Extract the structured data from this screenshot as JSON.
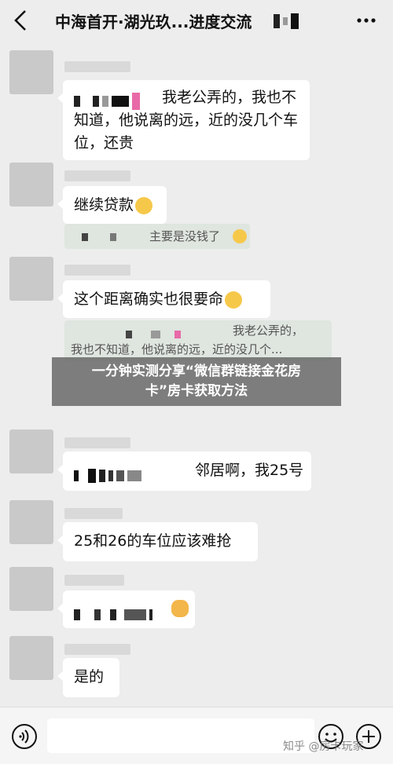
{
  "header": {
    "title": "中海首开·湖光玖...进度交流"
  },
  "messages": [
    {
      "text_visible": "我老公弄的，我也不知道，他说离的远，近的没几个车位，还贵"
    },
    {
      "text": "继续贷款"
    },
    {
      "quote": "主要是没钱了"
    },
    {
      "text": "这个距离确实也很要命"
    },
    {
      "quote_line1": "我老公弄的，",
      "quote_line2": "我也不知道，他说离的远，近的没几个..."
    },
    {
      "text_visible": "邻居啊，我25号"
    },
    {
      "text": "25和26的车位应该难抢"
    },
    {
      "text": "是的"
    }
  ],
  "banner": {
    "line1": "一分钟实测分享“微信群链接金花房",
    "line2": "卡”房卡获取方法"
  },
  "watermark": "知乎 @房卡玩家"
}
